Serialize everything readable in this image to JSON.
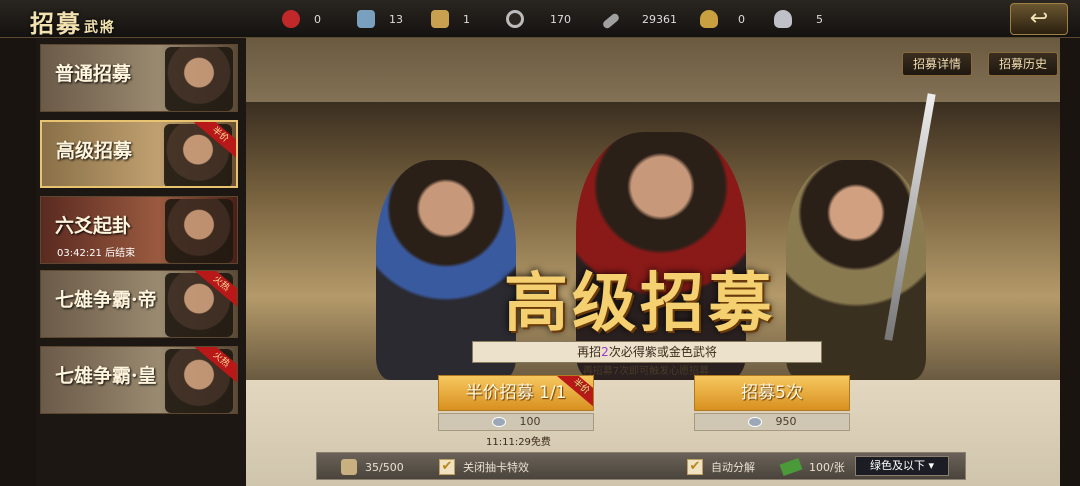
{
  "header": {
    "title_main": "招募",
    "title_sub": "武將",
    "resources": [
      {
        "name": "crest-icon",
        "value": "0",
        "color": "#c0282a"
      },
      {
        "name": "scroll-icon",
        "value": "13",
        "color": "#7aa0c0"
      },
      {
        "name": "book-icon",
        "value": "1",
        "color": "#c8a050"
      },
      {
        "name": "coil-icon",
        "value": "170",
        "color": "#bbbbbb"
      },
      {
        "name": "token-icon",
        "value": "29361",
        "color": "#a0a0a0"
      },
      {
        "name": "gold-ingot-icon",
        "value": "0",
        "color": "#c8a040"
      },
      {
        "name": "silver-ingot-icon",
        "value": "5",
        "color": "#c0c0c8"
      }
    ],
    "back_icon": "back-arrow-icon"
  },
  "sidebar": {
    "items": [
      {
        "label": "普通招募",
        "badge": "",
        "timer": ""
      },
      {
        "label": "高级招募",
        "badge": "半价",
        "timer": ""
      },
      {
        "label": "六爻起卦",
        "badge": "",
        "timer": "03:42:21 后结束"
      },
      {
        "label": "七雄争霸·帝",
        "badge": "火热",
        "timer": ""
      },
      {
        "label": "七雄争霸·皇",
        "badge": "火热",
        "timer": ""
      }
    ]
  },
  "main": {
    "banner_title": "高级招募",
    "details_button": "招募详情",
    "history_button": "招募历史",
    "hint_prefix": "再招",
    "hint_count": "2",
    "hint_suffix": "次必得紫或金色武将",
    "hint2": "再招募7次即可触发心愿招募",
    "half_price_button": "半价招募 1/1",
    "half_price_badge": "半价",
    "half_cost": "100",
    "free_timer": "11:11:29免费",
    "five_button": "招募5次",
    "five_cost": "950"
  },
  "bottom": {
    "capacity": "35/500",
    "close_effect_label": "关闭抽卡特效",
    "auto_decompose_label": "自动分解",
    "per_card": "100/张",
    "filter_label": "绿色及以下 ▾"
  }
}
